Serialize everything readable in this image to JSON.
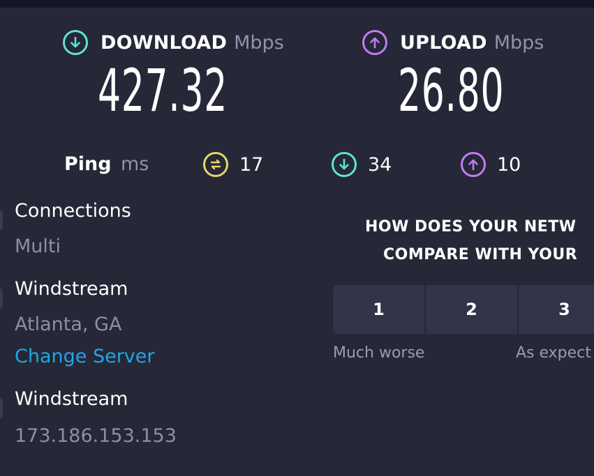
{
  "download": {
    "label": "DOWNLOAD",
    "unit": "Mbps",
    "value": "427.32",
    "icon": "arrow-down-circle-icon",
    "color": "#5ee5d2"
  },
  "upload": {
    "label": "UPLOAD",
    "unit": "Mbps",
    "value": "26.80",
    "icon": "arrow-up-circle-icon",
    "color": "#c07cf5"
  },
  "ping": {
    "label": "Ping",
    "unit": "ms",
    "idle": {
      "value": "17",
      "icon": "idle-latency-icon",
      "color": "#e7d56e"
    },
    "download": {
      "value": "34",
      "icon": "arrow-down-circle-icon",
      "color": "#5ee5d2"
    },
    "upload": {
      "value": "10",
      "icon": "arrow-up-circle-icon",
      "color": "#c07cf5"
    }
  },
  "connections": {
    "title": "Connections",
    "value": "Multi"
  },
  "server": {
    "title": "Windstream",
    "location": "Atlanta, GA",
    "change_label": "Change Server"
  },
  "isp": {
    "title": "Windstream",
    "ip": "173.186.153.153"
  },
  "survey": {
    "question_line1": "HOW DOES YOUR NETW",
    "question_line2": "COMPARE WITH YOUR",
    "options": [
      "1",
      "2",
      "3"
    ],
    "low_caption": "Much worse",
    "mid_caption": "As expect"
  },
  "colors": {
    "background": "#262737",
    "accent_link": "#1fa6e8"
  }
}
